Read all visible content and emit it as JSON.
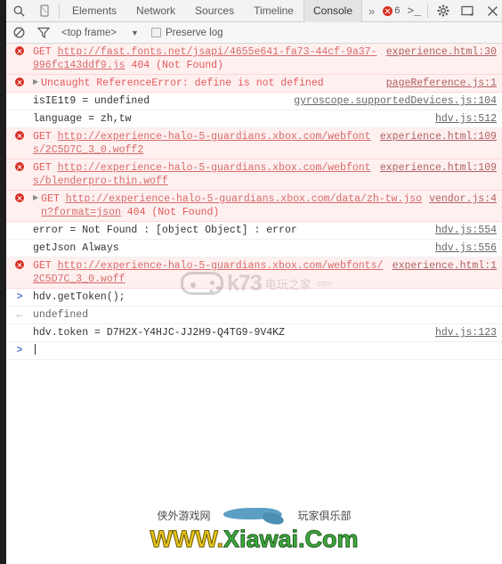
{
  "window": {
    "title": "Chrome DevTools - Console"
  },
  "toolbar": {
    "search_icon": "search-icon",
    "device_icon": "device-toggle-icon",
    "tabs": [
      {
        "label": "Elements",
        "active": false
      },
      {
        "label": "Network",
        "active": false
      },
      {
        "label": "Sources",
        "active": false
      },
      {
        "label": "Timeline",
        "active": false
      },
      {
        "label": "Console",
        "active": true
      }
    ],
    "more_tabs": "»",
    "error_count": "6",
    "console_prompt_icon": ">_",
    "settings_icon": "gear-icon",
    "dock_icon": "dock-position-icon",
    "close_icon": "close-icon"
  },
  "filterbar": {
    "clear_icon": "clear-console-icon",
    "filter_icon": "filter-funnel-icon",
    "frame_value": "<top frame>",
    "dropdown_caret": "▼",
    "preserve_log_label": "Preserve log",
    "preserve_log_checked": false
  },
  "colors": {
    "error_bg": "#fff0f0",
    "error_text": "#e45a5a",
    "link": "#d86a6a",
    "source_link": "#666666",
    "accent_prompt": "#5a7fd6",
    "error_badge": "#d93025"
  },
  "console": {
    "rows": [
      {
        "type": "error",
        "expandable": false,
        "prefix": "GET ",
        "url": "http://fast.fonts.net/jsapi/4655e641-fa73-44cf-9a37-996fc143ddf9.js",
        "suffix": " 404 (Not Found)",
        "source": "experience.html:30"
      },
      {
        "type": "error",
        "expandable": true,
        "prefix": "Uncaught ReferenceError: define is not defined",
        "url": "",
        "suffix": "",
        "source": "pageReference.js:1"
      },
      {
        "type": "log",
        "expandable": false,
        "prefix": "isIE1t9 = undefined",
        "url": "",
        "suffix": "",
        "source": "gyroscope.supportedDevices.js:104"
      },
      {
        "type": "log",
        "expandable": false,
        "prefix": "language = zh,tw",
        "url": "",
        "suffix": "",
        "source": "hdv.js:512"
      },
      {
        "type": "error",
        "expandable": false,
        "prefix": "GET ",
        "url": "http://experience-halo-5-guardians.xbox.com/webfonts/2C5D7C_3_0.woff2",
        "suffix": "",
        "source": "experience.html:109"
      },
      {
        "type": "error",
        "expandable": false,
        "prefix": "GET ",
        "url": "http://experience-halo-5-guardians.xbox.com/webfonts/blenderpro-thin.woff",
        "suffix": "",
        "source": "experience.html:109"
      },
      {
        "type": "error",
        "expandable": true,
        "prefix": "GET ",
        "url": "http://experience-halo-5-guardians.xbox.com/data/zh-tw.json?format=json",
        "suffix": " 404 (Not Found)",
        "source": "vendor.js:4"
      },
      {
        "type": "log",
        "expandable": false,
        "prefix": "error = Not Found : [object Object] : error",
        "url": "",
        "suffix": "",
        "source": "hdv.js:554"
      },
      {
        "type": "log",
        "expandable": false,
        "prefix": "getJson Always",
        "url": "",
        "suffix": "",
        "source": "hdv.js:556"
      },
      {
        "type": "error",
        "expandable": false,
        "prefix": "GET ",
        "url": "http://experience-halo-5-guardians.xbox.com/webfonts/2C5D7C_3_0.woff",
        "suffix": "",
        "source": "experience.html:1"
      },
      {
        "type": "input",
        "expandable": false,
        "prefix": "hdv.getToken();",
        "url": "",
        "suffix": "",
        "source": ""
      },
      {
        "type": "result",
        "expandable": false,
        "prefix": "undefined",
        "url": "",
        "suffix": "",
        "source": ""
      },
      {
        "type": "log",
        "expandable": false,
        "prefix": "hdv.token = D7H2X-Y4HJC-JJ2H9-Q4TG9-9V4KZ",
        "url": "",
        "suffix": "",
        "source": "hdv.js:123"
      }
    ],
    "input_prompt": ">",
    "input_value": ""
  },
  "watermarks": {
    "center": {
      "text": "k73",
      "subtext": "电玩之家",
      "domain": ".com"
    },
    "bottom_left_cn": "侠外游戏网",
    "bottom_right_cn": "玩家俱乐部",
    "bottom_url_part1": "WWW.",
    "bottom_url_part2": "Xiawai",
    "bottom_url_part3": ".Com"
  }
}
